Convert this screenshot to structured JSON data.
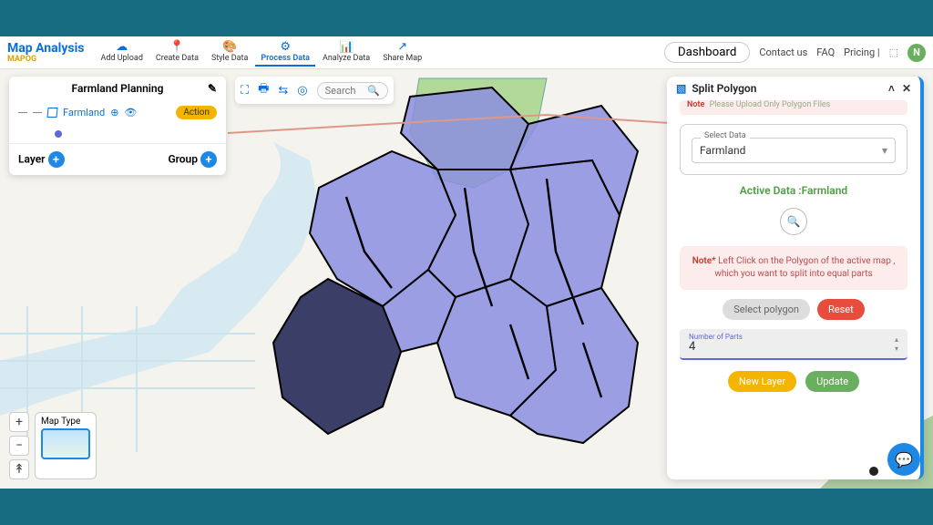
{
  "header": {
    "logo": "Map Analysis",
    "logo_sub": "MAPOG",
    "items": [
      {
        "icon": "☁",
        "label": "Add Upload"
      },
      {
        "icon": "📍",
        "label": "Create Data"
      },
      {
        "icon": "🎨",
        "label": "Style Data"
      },
      {
        "icon": "⚙",
        "label": "Process Data"
      },
      {
        "icon": "📊",
        "label": "Analyze Data"
      },
      {
        "icon": "↗",
        "label": "Share Map"
      }
    ],
    "dashboard": "Dashboard",
    "links": [
      "Contact us",
      "FAQ",
      "Pricing |"
    ],
    "avatar_initial": "N"
  },
  "layer_panel": {
    "title": "Farmland Planning",
    "layer_name": "Farmland",
    "action_label": "Action",
    "foot_left": "Layer",
    "foot_right": "Group"
  },
  "map_tools": {
    "search_placeholder": "Search"
  },
  "maptype": {
    "label": "Map Type"
  },
  "split_panel": {
    "title": "Split Polygon",
    "top_note_title": "Note",
    "top_note_text": "Please Upload Only Polygon Files",
    "select_label": "Select Data",
    "select_value": "Farmland",
    "active_data": "Active Data :Farmland",
    "note_title": "Note*",
    "note_text": "Left Click on the Polygon of the active map , which you want to split into equal parts",
    "select_polygon": "Select polygon",
    "reset": "Reset",
    "parts_label": "Number of Parts",
    "parts_value": "4",
    "new_layer": "New Layer",
    "update": "Update"
  }
}
